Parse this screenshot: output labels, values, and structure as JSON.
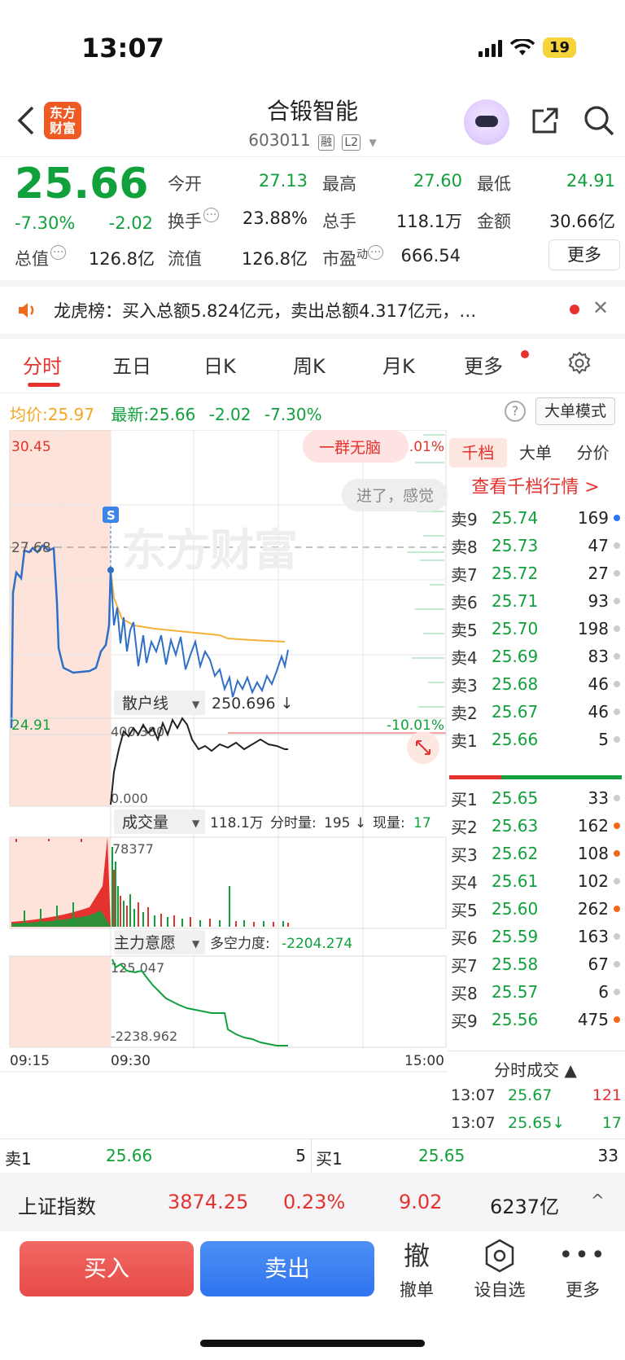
{
  "status": {
    "time": "13:07",
    "battery": "19"
  },
  "header": {
    "logo_line1": "东方",
    "logo_line2": "财富",
    "stock_name": "合锻智能",
    "stock_code": "603011",
    "tag_rong": "融",
    "tag_level": "L2"
  },
  "quote": {
    "price": "25.66",
    "change_pct": "-7.30%",
    "change_amt": "-2.02",
    "open_label": "今开",
    "open_value": "27.13",
    "high_label": "最高",
    "high_value": "27.60",
    "low_label": "最低",
    "low_value": "24.91",
    "turnover_label": "换手",
    "turnover_value": "23.88%",
    "volume_label": "总手",
    "volume_value": "118.1万",
    "amount_label": "金额",
    "amount_value": "30.66亿",
    "mcap_label": "总值",
    "mcap_value": "126.8亿",
    "float_label": "流值",
    "float_value": "126.8亿",
    "pe_label": "市盈",
    "pe_sup": "动",
    "pe_value": "666.54",
    "more_label": "更多"
  },
  "news": {
    "text": "龙虎榜：买入总额5.824亿元，卖出总额4.317亿元，…",
    "dot_color": "#e5322e"
  },
  "tabs": [
    "分时",
    "五日",
    "日K",
    "周K",
    "月K",
    "更多"
  ],
  "info_line": {
    "avg_label": "均价:",
    "avg_value": "25.97",
    "latest_label": "最新:",
    "latest_value": "25.66",
    "latest_change": "-2.02",
    "latest_pct": "-7.30%",
    "mode_label": "大单模式"
  },
  "chart_labels": {
    "y_top": "30.45",
    "y_bottom": "24.91",
    "y_ref": "27.68",
    "pct_top": "10.01%",
    "pct_bottom": "-10.01%",
    "comment_1": "一群无脑",
    "comment_2": "进了，感觉",
    "marker": "S",
    "retail_selector": "散户线",
    "retail_value": "250.696 ↓",
    "retail_max": "400.380",
    "retail_min": "0.000",
    "vol_selector": "成交量",
    "vol_total": "118.1万",
    "vol_tick_label": "分时量:",
    "vol_tick_value": "195 ↓",
    "vol_now_label": "现量:",
    "vol_now_value": "17",
    "vol_max": "78377",
    "main_selector": "主力意愿",
    "main_label": "多空力度:",
    "main_value": "-2204.274",
    "main_max": "125.047",
    "main_min": "-2238.962",
    "time_start": "09:15",
    "time_mid": "09:30",
    "time_end": "15:00",
    "watermark": "东方财富"
  },
  "orderbook": {
    "tabs": [
      "千档",
      "大单",
      "分价"
    ],
    "link": "查看千档行情 >",
    "asks": [
      {
        "label": "卖9",
        "price": "25.74",
        "qty": "169",
        "dot": "#2f74ee"
      },
      {
        "label": "卖8",
        "price": "25.73",
        "qty": "47",
        "dot": "#cccccc"
      },
      {
        "label": "卖7",
        "price": "25.72",
        "qty": "27",
        "dot": "#cccccc"
      },
      {
        "label": "卖6",
        "price": "25.71",
        "qty": "93",
        "dot": "#cccccc"
      },
      {
        "label": "卖5",
        "price": "25.70",
        "qty": "198",
        "dot": "#cccccc"
      },
      {
        "label": "卖4",
        "price": "25.69",
        "qty": "83",
        "dot": "#cccccc"
      },
      {
        "label": "卖3",
        "price": "25.68",
        "qty": "46",
        "dot": "#cccccc"
      },
      {
        "label": "卖2",
        "price": "25.67",
        "qty": "46",
        "dot": "#cccccc"
      },
      {
        "label": "卖1",
        "price": "25.66",
        "qty": "5",
        "dot": "#cccccc"
      }
    ],
    "bids": [
      {
        "label": "买1",
        "price": "25.65",
        "qty": "33",
        "dot": "#cccccc"
      },
      {
        "label": "买2",
        "price": "25.63",
        "qty": "162",
        "dot": "#f06a1d"
      },
      {
        "label": "买3",
        "price": "25.62",
        "qty": "108",
        "dot": "#f06a1d"
      },
      {
        "label": "买4",
        "price": "25.61",
        "qty": "102",
        "dot": "#cccccc"
      },
      {
        "label": "买5",
        "price": "25.60",
        "qty": "262",
        "dot": "#f06a1d"
      },
      {
        "label": "买6",
        "price": "25.59",
        "qty": "163",
        "dot": "#cccccc"
      },
      {
        "label": "买7",
        "price": "25.58",
        "qty": "67",
        "dot": "#cccccc"
      },
      {
        "label": "买8",
        "price": "25.57",
        "qty": "6",
        "dot": "#cccccc"
      },
      {
        "label": "买9",
        "price": "25.56",
        "qty": "475",
        "dot": "#f06a1d"
      }
    ],
    "trades_title": "分时成交 ▲",
    "trades": [
      {
        "time": "13:07",
        "price": "25.67",
        "vol": "121",
        "color": "#e5322e"
      },
      {
        "time": "13:07",
        "price": "25.65↓",
        "vol": "17",
        "color": "#11a13c"
      }
    ]
  },
  "bottom_strip": {
    "sell_label": "卖1",
    "sell_price": "25.66",
    "sell_qty": "5",
    "buy_label": "买1",
    "buy_price": "25.65",
    "buy_qty": "33"
  },
  "index_bar": {
    "name": "上证指数",
    "value": "3874.25",
    "pct": "0.23%",
    "change": "9.02",
    "amount": "6237亿",
    "chevron": "^"
  },
  "actions": {
    "buy": "买入",
    "sell": "卖出",
    "cancel_icon": "撤",
    "cancel": "撤单",
    "watch": "设自选",
    "more": "更多"
  }
}
